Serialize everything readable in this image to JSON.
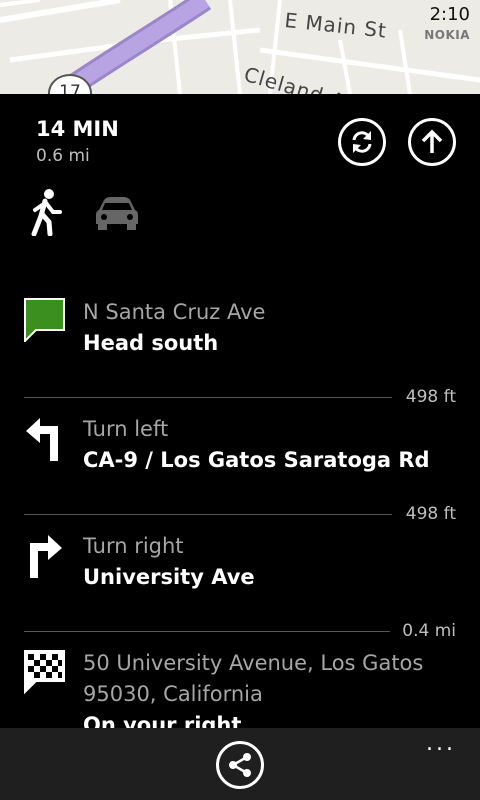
{
  "status_bar": {
    "time": "2:10",
    "brand": "NOKIA"
  },
  "map": {
    "streets": [
      "E Main St",
      "Cleland Ave"
    ],
    "route_shield": "17"
  },
  "summary": {
    "duration": "14 MIN",
    "distance": "0.6 mi"
  },
  "modes": [
    {
      "name": "walk",
      "icon": "walking-person-icon",
      "selected": true
    },
    {
      "name": "drive",
      "icon": "car-icon",
      "selected": false
    }
  ],
  "steps": [
    {
      "icon": "start-flag-icon",
      "label": "N Santa Cruz Ave",
      "detail": "Head south",
      "distance_after": "498 ft"
    },
    {
      "icon": "turn-left-icon",
      "label": "Turn left",
      "detail": "CA-9 / Los Gatos Saratoga Rd",
      "distance_after": "498 ft"
    },
    {
      "icon": "turn-right-icon",
      "label": "Turn right",
      "detail": "University Ave",
      "distance_after": "0.4 mi"
    },
    {
      "icon": "finish-flag-icon",
      "label_lines": [
        "50 University Avenue, Los Gatos",
        "95030, California"
      ],
      "detail": "On your right"
    }
  ],
  "appbar": {
    "more": "..."
  },
  "colors": {
    "accent_green": "#3a8f1f",
    "map_route": "#b8a3e3",
    "background": "#000000",
    "appbar": "#1f1f1f"
  }
}
